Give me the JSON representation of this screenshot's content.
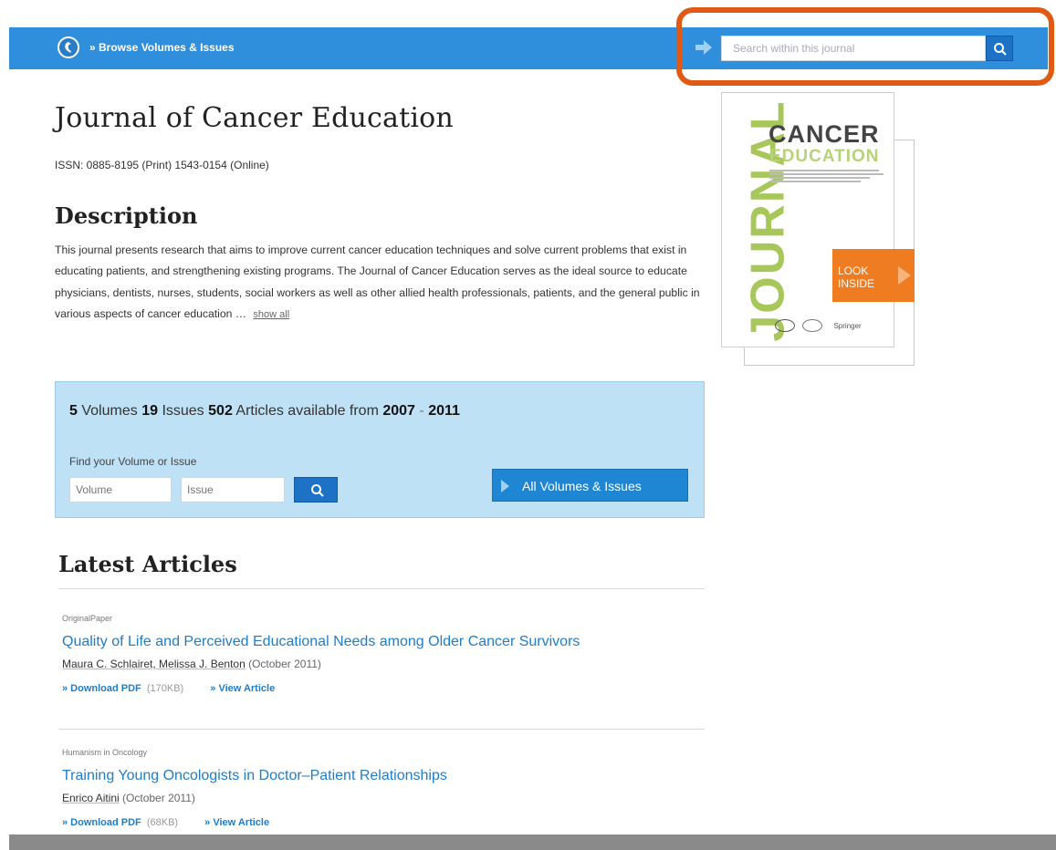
{
  "header": {
    "browse_label": "» Browse Volumes & Issues",
    "search_placeholder": "Search within this journal",
    "accent_color": "#2f8fdc",
    "highlight_color": "#e05a14"
  },
  "journal": {
    "title": "Journal of Cancer Education",
    "issn": "ISSN: 0885-8195 (Print) 1543-0154 (Online)",
    "description_heading": "Description",
    "description": "This journal presents research that aims to improve current cancer education techniques and solve current problems that exist in educating patients, and strengthening existing programs. The Journal of Cancer Education serves as the ideal source to educate physicians, dentists, nurses, students, social workers as well as other allied health professionals, patients, and the general public in various aspects of cancer education …",
    "show_all": "show all"
  },
  "cover": {
    "vertical_word": "JOURNAL",
    "cancer": "CANCER",
    "education": "EDUCATION",
    "look_inside_line1": "LOOK",
    "look_inside_line2": "INSIDE",
    "publisher": "Springer"
  },
  "volumes": {
    "volume_count": "5",
    "volumes_label": "Volumes",
    "issue_count": "19",
    "issues_label": "Issues",
    "article_count": "502",
    "articles_label": "Articles available from",
    "year_from": "2007",
    "year_sep": "-",
    "year_to": "2011",
    "find_label": "Find your Volume or Issue",
    "volume_placeholder": "Volume",
    "issue_placeholder": "Issue",
    "all_button": "All Volumes & Issues"
  },
  "latest": {
    "heading": "Latest Articles",
    "articles": [
      {
        "type": "OriginalPaper",
        "title": "Quality of Life and Perceived Educational Needs among Older Cancer Survivors",
        "authors": "Maura C. Schlairet, Melissa J. Benton",
        "date": "(October 2011)",
        "download": "» Download PDF",
        "size": "(170KB)",
        "view": "» View Article"
      },
      {
        "type": "Humanism in Oncology",
        "title": "Training Young Oncologists in Doctor–Patient Relationships",
        "authors": "Enrico Aitini",
        "date": "(October 2011)",
        "download": "» Download PDF",
        "size": "(68KB)",
        "view": "» View Article"
      }
    ]
  }
}
